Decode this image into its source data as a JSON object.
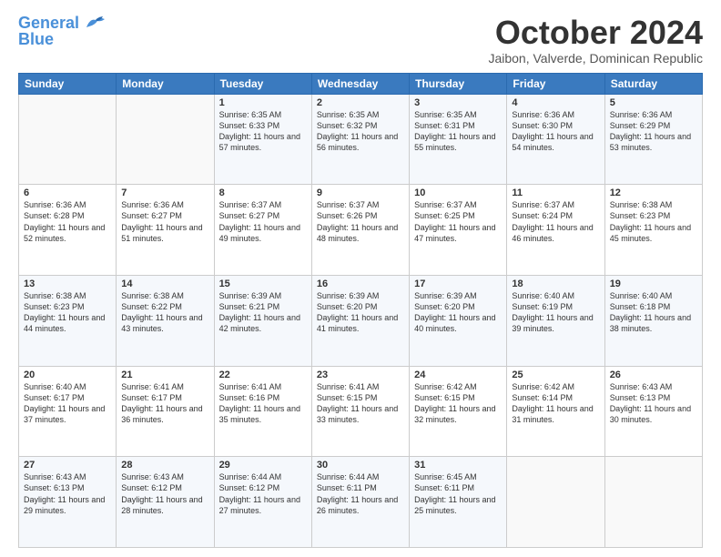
{
  "logo": {
    "line1": "General",
    "line2": "Blue"
  },
  "title": "October 2024",
  "subtitle": "Jaibon, Valverde, Dominican Republic",
  "days_of_week": [
    "Sunday",
    "Monday",
    "Tuesday",
    "Wednesday",
    "Thursday",
    "Friday",
    "Saturday"
  ],
  "weeks": [
    [
      {
        "day": "",
        "info": ""
      },
      {
        "day": "",
        "info": ""
      },
      {
        "day": "1",
        "info": "Sunrise: 6:35 AM\nSunset: 6:33 PM\nDaylight: 11 hours and 57 minutes."
      },
      {
        "day": "2",
        "info": "Sunrise: 6:35 AM\nSunset: 6:32 PM\nDaylight: 11 hours and 56 minutes."
      },
      {
        "day": "3",
        "info": "Sunrise: 6:35 AM\nSunset: 6:31 PM\nDaylight: 11 hours and 55 minutes."
      },
      {
        "day": "4",
        "info": "Sunrise: 6:36 AM\nSunset: 6:30 PM\nDaylight: 11 hours and 54 minutes."
      },
      {
        "day": "5",
        "info": "Sunrise: 6:36 AM\nSunset: 6:29 PM\nDaylight: 11 hours and 53 minutes."
      }
    ],
    [
      {
        "day": "6",
        "info": "Sunrise: 6:36 AM\nSunset: 6:28 PM\nDaylight: 11 hours and 52 minutes."
      },
      {
        "day": "7",
        "info": "Sunrise: 6:36 AM\nSunset: 6:27 PM\nDaylight: 11 hours and 51 minutes."
      },
      {
        "day": "8",
        "info": "Sunrise: 6:37 AM\nSunset: 6:27 PM\nDaylight: 11 hours and 49 minutes."
      },
      {
        "day": "9",
        "info": "Sunrise: 6:37 AM\nSunset: 6:26 PM\nDaylight: 11 hours and 48 minutes."
      },
      {
        "day": "10",
        "info": "Sunrise: 6:37 AM\nSunset: 6:25 PM\nDaylight: 11 hours and 47 minutes."
      },
      {
        "day": "11",
        "info": "Sunrise: 6:37 AM\nSunset: 6:24 PM\nDaylight: 11 hours and 46 minutes."
      },
      {
        "day": "12",
        "info": "Sunrise: 6:38 AM\nSunset: 6:23 PM\nDaylight: 11 hours and 45 minutes."
      }
    ],
    [
      {
        "day": "13",
        "info": "Sunrise: 6:38 AM\nSunset: 6:23 PM\nDaylight: 11 hours and 44 minutes."
      },
      {
        "day": "14",
        "info": "Sunrise: 6:38 AM\nSunset: 6:22 PM\nDaylight: 11 hours and 43 minutes."
      },
      {
        "day": "15",
        "info": "Sunrise: 6:39 AM\nSunset: 6:21 PM\nDaylight: 11 hours and 42 minutes."
      },
      {
        "day": "16",
        "info": "Sunrise: 6:39 AM\nSunset: 6:20 PM\nDaylight: 11 hours and 41 minutes."
      },
      {
        "day": "17",
        "info": "Sunrise: 6:39 AM\nSunset: 6:20 PM\nDaylight: 11 hours and 40 minutes."
      },
      {
        "day": "18",
        "info": "Sunrise: 6:40 AM\nSunset: 6:19 PM\nDaylight: 11 hours and 39 minutes."
      },
      {
        "day": "19",
        "info": "Sunrise: 6:40 AM\nSunset: 6:18 PM\nDaylight: 11 hours and 38 minutes."
      }
    ],
    [
      {
        "day": "20",
        "info": "Sunrise: 6:40 AM\nSunset: 6:17 PM\nDaylight: 11 hours and 37 minutes."
      },
      {
        "day": "21",
        "info": "Sunrise: 6:41 AM\nSunset: 6:17 PM\nDaylight: 11 hours and 36 minutes."
      },
      {
        "day": "22",
        "info": "Sunrise: 6:41 AM\nSunset: 6:16 PM\nDaylight: 11 hours and 35 minutes."
      },
      {
        "day": "23",
        "info": "Sunrise: 6:41 AM\nSunset: 6:15 PM\nDaylight: 11 hours and 33 minutes."
      },
      {
        "day": "24",
        "info": "Sunrise: 6:42 AM\nSunset: 6:15 PM\nDaylight: 11 hours and 32 minutes."
      },
      {
        "day": "25",
        "info": "Sunrise: 6:42 AM\nSunset: 6:14 PM\nDaylight: 11 hours and 31 minutes."
      },
      {
        "day": "26",
        "info": "Sunrise: 6:43 AM\nSunset: 6:13 PM\nDaylight: 11 hours and 30 minutes."
      }
    ],
    [
      {
        "day": "27",
        "info": "Sunrise: 6:43 AM\nSunset: 6:13 PM\nDaylight: 11 hours and 29 minutes."
      },
      {
        "day": "28",
        "info": "Sunrise: 6:43 AM\nSunset: 6:12 PM\nDaylight: 11 hours and 28 minutes."
      },
      {
        "day": "29",
        "info": "Sunrise: 6:44 AM\nSunset: 6:12 PM\nDaylight: 11 hours and 27 minutes."
      },
      {
        "day": "30",
        "info": "Sunrise: 6:44 AM\nSunset: 6:11 PM\nDaylight: 11 hours and 26 minutes."
      },
      {
        "day": "31",
        "info": "Sunrise: 6:45 AM\nSunset: 6:11 PM\nDaylight: 11 hours and 25 minutes."
      },
      {
        "day": "",
        "info": ""
      },
      {
        "day": "",
        "info": ""
      }
    ]
  ]
}
